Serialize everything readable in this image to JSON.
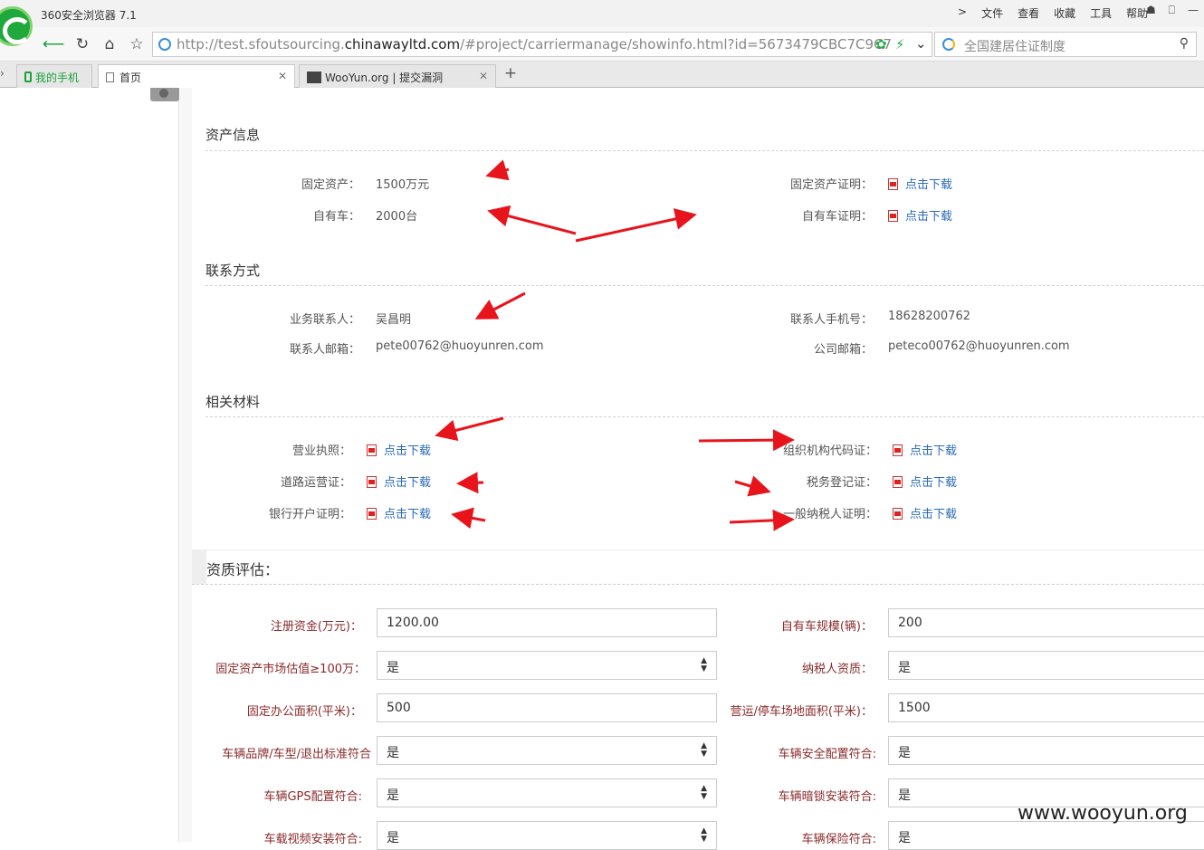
{
  "browser": {
    "title": "360安全浏览器 7.1",
    "menu": [
      "文件",
      "查看",
      "收藏",
      "工具",
      "帮助"
    ],
    "url_prefix": "http://test.sfoutsourcing.",
    "url_domain": "chinawayltd.com",
    "url_suffix": "/#project/carriermanage/showinfo.html?id=5673479CBC7C9C7",
    "search_placeholder": "全国建居住证制度",
    "tabs": [
      {
        "label": "我的手机"
      },
      {
        "label": "首页"
      },
      {
        "label": "WooYun.org | 提交漏洞"
      }
    ]
  },
  "assets": {
    "title": "资产信息",
    "fixed_assets_label": "固定资产：",
    "fixed_assets_value": "1500万元",
    "own_vehicles_label": "自有车：",
    "own_vehicles_value": "2000台",
    "fixed_assets_proof_label": "固定资产证明：",
    "own_vehicles_proof_label": "自有车证明：",
    "download": "点击下载"
  },
  "contact": {
    "title": "联系方式",
    "contact_person_label": "业务联系人：",
    "contact_person_value": "吴昌明",
    "contact_email_label": "联系人邮箱：",
    "contact_email_value": "pete00762@huoyunren.com",
    "contact_phone_label": "联系人手机号：",
    "contact_phone_value": "18628200762",
    "company_email_label": "公司邮箱：",
    "company_email_value": "peteco00762@huoyunren.com"
  },
  "materials": {
    "title": "相关材料",
    "business_license": "营业执照：",
    "road_transport": "道路运营证：",
    "bank_account": "银行开户证明：",
    "org_code": "组织机构代码证：",
    "tax_registration": "税务登记证：",
    "taxpayer": "一般纳税人证明：",
    "download": "点击下载"
  },
  "evaluation": {
    "title": "资质评估：",
    "registered_capital_label": "注册资金(万元)：",
    "registered_capital_value": "1200.00",
    "fixed_assets_market_label": "固定资产市场估值≥100万：",
    "fixed_assets_market_value": "是",
    "office_area_label": "固定办公面积(平米)：",
    "office_area_value": "500",
    "vehicle_brand_label": "车辆品牌/车型/退出标准符合",
    "vehicle_brand_value": "是",
    "vehicle_gps_label": "车辆GPS配置符合:",
    "vehicle_gps_value": "是",
    "vehicle_video_label": "车载视频安装符合:",
    "vehicle_video_value": "是",
    "fleet_size_label": "自有车规模(辆)：",
    "fleet_size_value": "200",
    "taxpayer_label": "纳税人资质：",
    "taxpayer_value": "是",
    "parking_area_label": "营运/停车场地面积(平米)：",
    "parking_area_value": "1500",
    "vehicle_safety_label": "车辆安全配置符合:",
    "vehicle_safety_value": "是",
    "vehicle_lock_label": "车辆暗锁安装符合:",
    "vehicle_lock_value": "是",
    "vehicle_insurance_label": "车辆保险符合:",
    "vehicle_insurance_value": "是"
  },
  "watermark": "www.wooyun.org",
  "colors": {
    "arrow": "#e8141b",
    "link": "#2a6bb8",
    "form_label": "#8a2a2a"
  }
}
